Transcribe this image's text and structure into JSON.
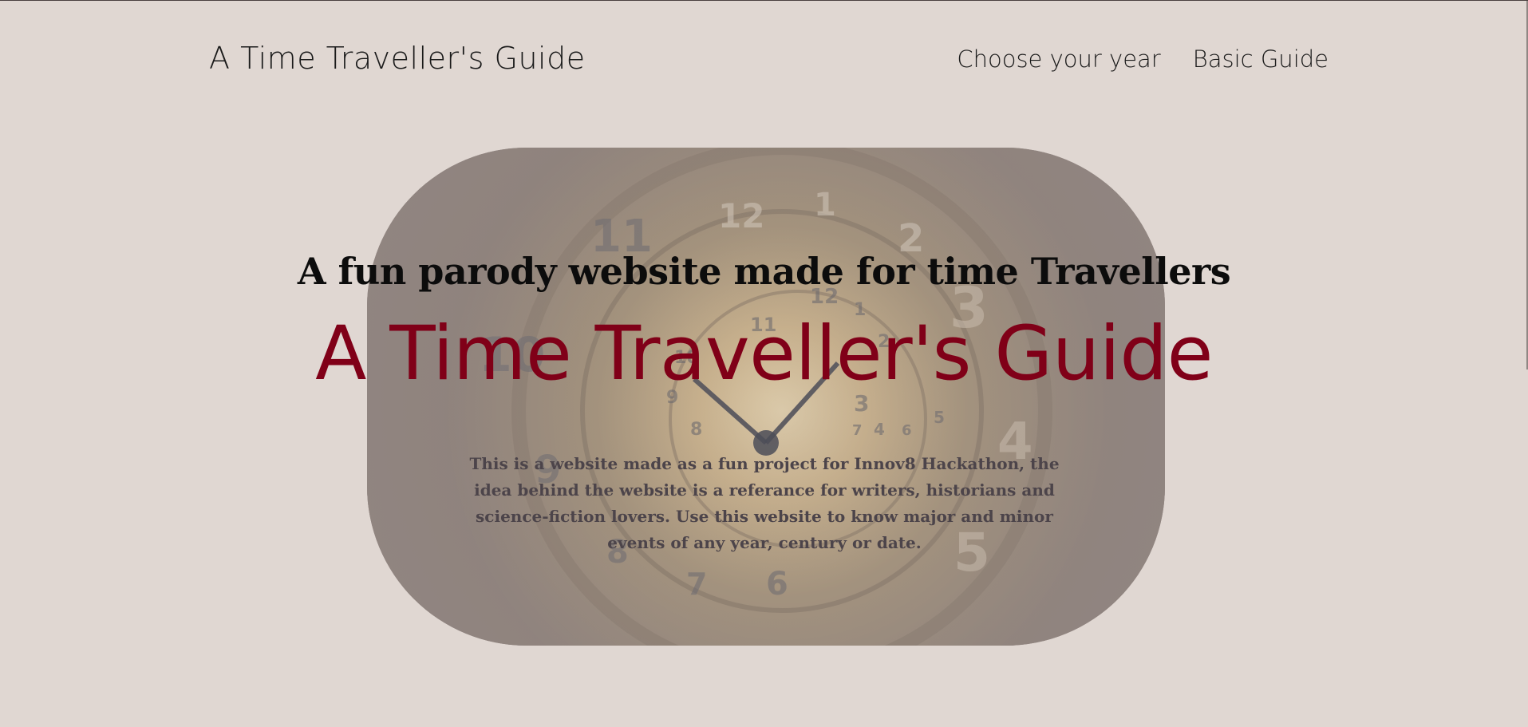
{
  "navbar": {
    "brand": "A Time Traveller's Guide",
    "links": [
      {
        "label": "Choose your year"
      },
      {
        "label": "Basic Guide"
      }
    ]
  },
  "hero": {
    "image_icon": "clock-image",
    "clock_numerals": [
      "12",
      "1",
      "2",
      "3",
      "4",
      "5",
      "6",
      "7",
      "8",
      "9",
      "10",
      "11",
      "12",
      "1",
      "2",
      "3",
      "4",
      "5",
      "6",
      "7",
      "8",
      "9",
      "10",
      "11"
    ],
    "tagline": "A fun parody website made for time Travellers",
    "title": "A Time Traveller's Guide",
    "description": "This is a website made as a fun project for Innov8 Hackathon, the idea behind the website is a referance for writers, historians and science-fiction lovers. Use this website to know major and minor events of any year, century or date."
  },
  "colors": {
    "background": "#e0d7d2",
    "accent": "#800018",
    "card": "#9b9397"
  }
}
